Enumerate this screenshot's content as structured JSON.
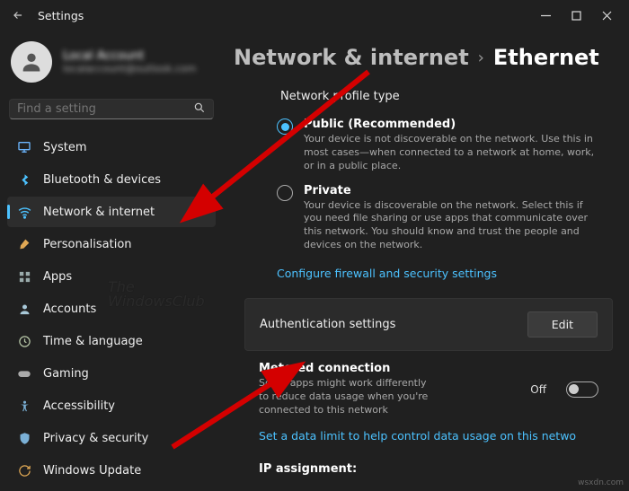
{
  "window": {
    "title": "Settings"
  },
  "profile": {
    "name": "Local Account",
    "email": "localaccount@outlook.com"
  },
  "search": {
    "placeholder": "Find a setting"
  },
  "nav": [
    {
      "label": "System"
    },
    {
      "label": "Bluetooth & devices"
    },
    {
      "label": "Network & internet"
    },
    {
      "label": "Personalisation"
    },
    {
      "label": "Apps"
    },
    {
      "label": "Accounts"
    },
    {
      "label": "Time & language"
    },
    {
      "label": "Gaming"
    },
    {
      "label": "Accessibility"
    },
    {
      "label": "Privacy & security"
    },
    {
      "label": "Windows Update"
    }
  ],
  "breadcrumb": {
    "parent": "Network & internet",
    "current": "Ethernet"
  },
  "section": {
    "profile_type": "Network profile type"
  },
  "public_opt": {
    "title": "Public (Recommended)",
    "desc": "Your device is not discoverable on the network. Use this in most cases—when connected to a network at home, work, or in a public place."
  },
  "private_opt": {
    "title": "Private",
    "desc": "Your device is discoverable on the network. Select this if you need file sharing or use apps that communicate over this network. You should know and trust the people and devices on the network."
  },
  "firewall_link": "Configure firewall and security settings",
  "auth": {
    "title": "Authentication settings",
    "button": "Edit"
  },
  "metered": {
    "title": "Metered connection",
    "desc": "Some apps might work differently to reduce data usage when you're connected to this network",
    "state": "Off"
  },
  "data_limit_link": "Set a data limit to help control data usage on this netwo",
  "ip": {
    "label": "IP assignment:"
  },
  "watermark": {
    "l1": "The",
    "l2": "WindowsClub"
  },
  "corner": "wsxdn.com"
}
